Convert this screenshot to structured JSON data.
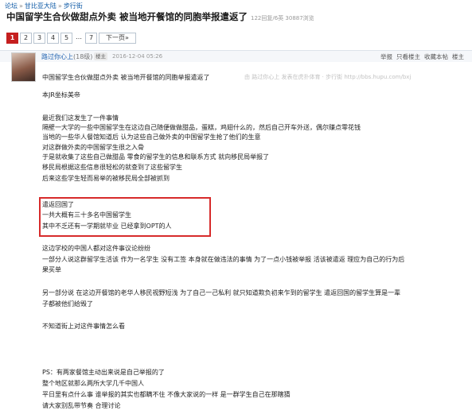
{
  "breadcrumb": {
    "items": [
      "论坛",
      "甘比亚大陆",
      "步行街"
    ],
    "separator": "»"
  },
  "thread": {
    "title": "中国留学生合伙做甜点外卖 被当地开餐馆的同胞举报遣返了",
    "meta": "122回复/6英 30887浏览"
  },
  "pagination": {
    "pages": [
      "1",
      "2",
      "3",
      "4",
      "5",
      "…",
      "7"
    ],
    "current": "1",
    "next_label": "下一页»"
  },
  "post": {
    "author": "路过你心上",
    "author_level": "(18级)",
    "badge": "楼主",
    "time": "2016-12-04 05:26",
    "tools": [
      "举报",
      "只看楼主",
      "收藏本帖",
      "楼主"
    ],
    "watermark": "由 路过你心上 发表在虎扑体育 · 步行街 http://bbs.hupu.com/bxj",
    "lines": [
      "中国留学生合伙做甜点外卖 被当地开餐馆的同胞举报遣返了",
      "",
      "本JR坐标美帝",
      "",
      "最近我们这发生了一件事情",
      "隔壁一大学的一些中国留学生在这边自己随便做做甜品，蛋糕，鸡翅什么的，然后自己开车外送，偶尔赚点零花钱",
      "当地的一些华人餐馆知道后 认为这些自己做外卖的中国留学生抢了他们的生意",
      "对这群做外卖的中国留学生很之入骨",
      "于是就收集了这些自己做甜品 零食的留学生的信息和联系方式 就向移民局举报了",
      "移民局根据这些信息很轻松的就查到了这些留学生",
      "后来这些学生轻而易举的被移民局全部被抓到",
      "遣返回国了",
      "一共大概有三十多名中国留学生",
      "其中不乏还有一学期就毕业 已经拿到OPT的人",
      "",
      "这边学校的中国人都对这件事议论纷纷",
      "一部分人说这群留学生活该 作为一名学生 没有工签 本身就在做违法的事情 为了一点小钱被举报 活该被遣返 理应为自己的行为后",
      "果买单",
      "",
      "另一部分说 在这边开餐馆的老华人移民视野短浅 为了自己一己私利 就只知道欺负初来乍到的留学生 遣返回国的留学生算是一辈",
      "子都被他们给毁了",
      "",
      "不知道街上对这件事情怎么看",
      "",
      "",
      "",
      "PS：有两家餐馆主动出来说是自己举报的了",
      "整个地区就那么两所大学几千中国人",
      "平日里有点什么事 谁举报的其实也都瞒不住 不像大家说的一样 是一群学生自己在那瞎猜",
      "请大家别乱带节奏 合理讨论"
    ]
  }
}
